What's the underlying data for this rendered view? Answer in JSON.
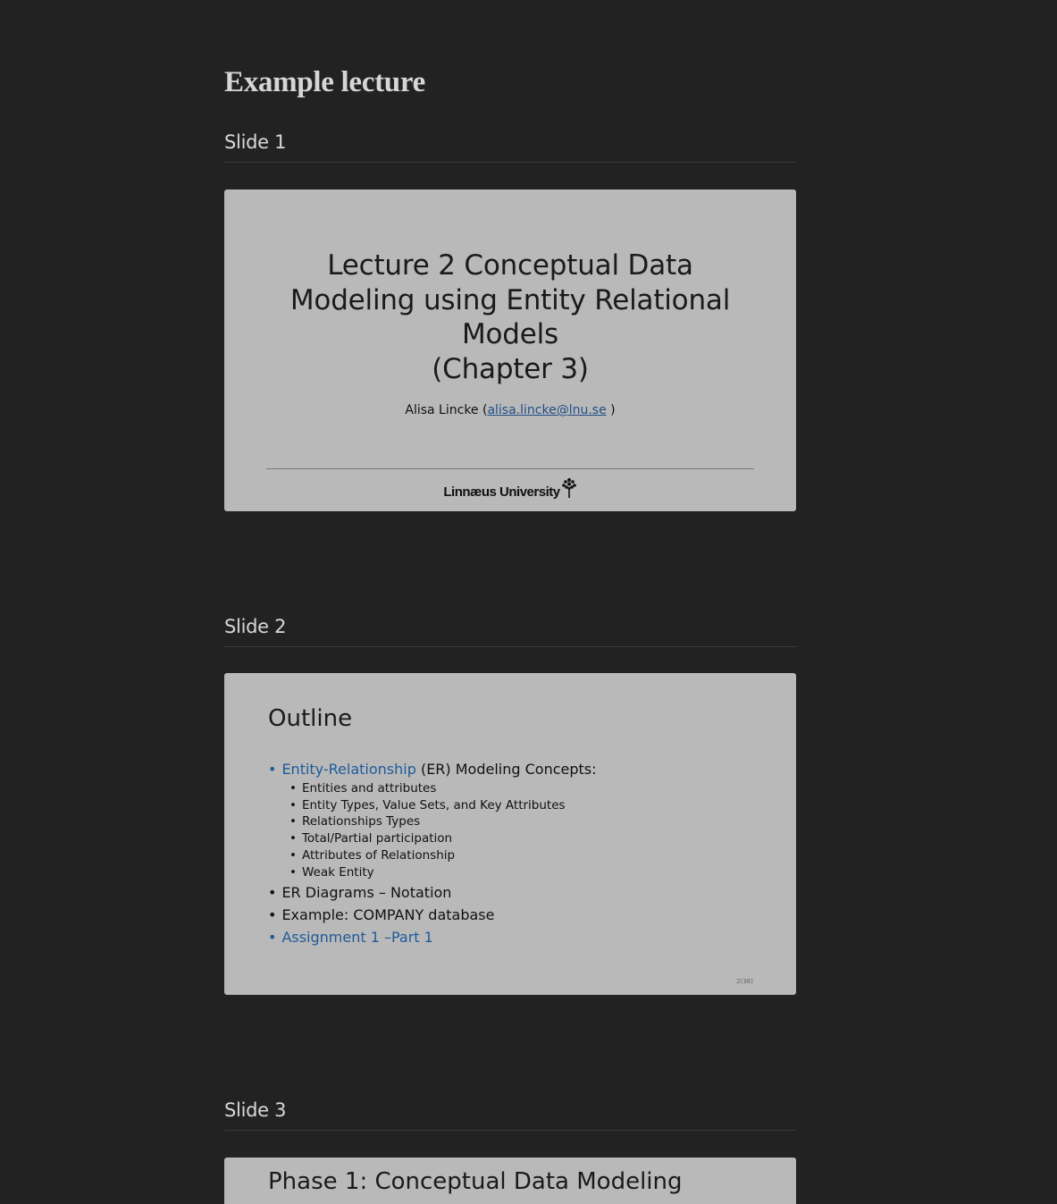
{
  "page": {
    "title": "Example lecture"
  },
  "slides": [
    {
      "heading": "Slide 1",
      "title_lines": [
        "Lecture 2 Conceptual Data",
        "Modeling using Entity Relational",
        "Models",
        "(Chapter 3)"
      ],
      "author_prefix": "Alisa Lincke (",
      "author_email": "alisa.lincke@lnu.se",
      "author_suffix": " )",
      "logo_text": "Linnæus University"
    },
    {
      "heading": "Slide 2",
      "title": "Outline",
      "items": [
        {
          "link": "Entity-Relationship",
          "text": " (ER) Modeling Concepts:"
        },
        {
          "text": "ER Diagrams – Notation"
        },
        {
          "text": "Example:  COMPANY database"
        },
        {
          "link": "Assignment 1 –Part 1"
        }
      ],
      "subitems": [
        "Entities and attributes",
        "Entity Types, Value Sets, and Key Attributes",
        "Relationships Types",
        "Total/Partial participation",
        "Attributes of Relationship",
        "Weak Entity"
      ],
      "page_number": "2(36)"
    },
    {
      "heading": "Slide 3",
      "title": "Phase 1: Conceptual Data Modeling"
    }
  ],
  "colors": {
    "background": "#222222",
    "slide_bg": "#b9b9b9",
    "link": "#1f5a9a"
  }
}
